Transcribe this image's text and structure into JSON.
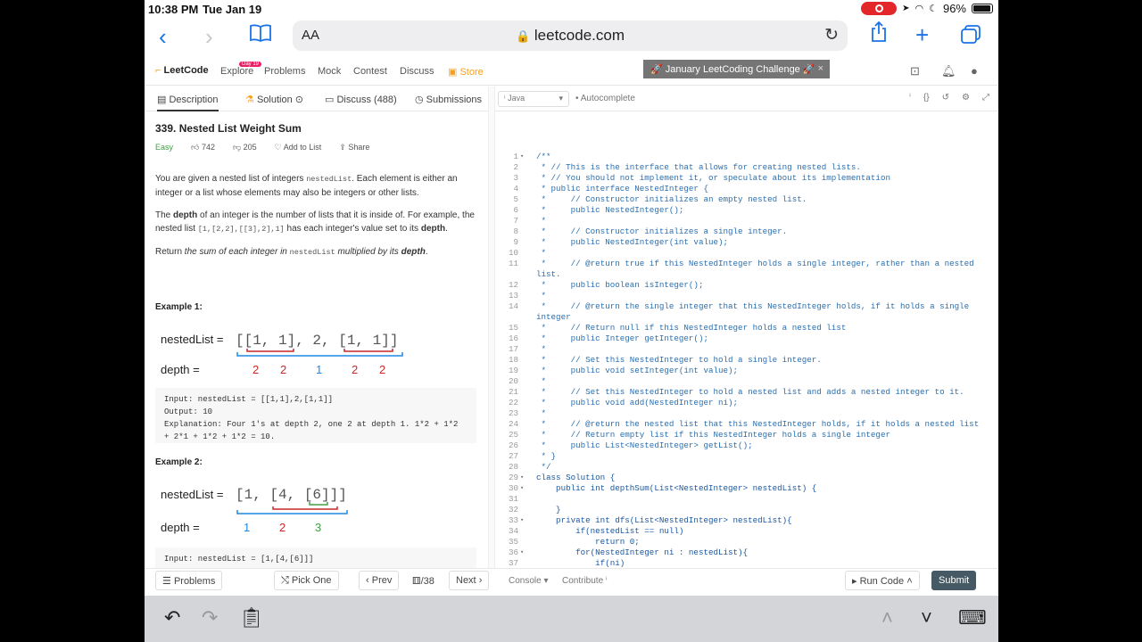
{
  "status": {
    "time": "10:38 PM",
    "date": "Tue Jan 19",
    "battery": "96%"
  },
  "safari": {
    "aa": "AA",
    "url": "leetcode.com"
  },
  "lcnav": {
    "logo_a": "Leet",
    "logo_b": "Code",
    "items": [
      "Explore",
      "Problems",
      "Mock",
      "Contest",
      "Discuss",
      "Store"
    ],
    "badge": "Day 19",
    "banner": "🚀 January LeetCoding Challenge 🚀"
  },
  "tabs": [
    "Description",
    "Solution",
    "Discuss (488)",
    "Submissions"
  ],
  "question": {
    "title": "339. Nested List Weight Sum",
    "difficulty": "Easy",
    "likes": "742",
    "dislikes": "205",
    "add_to_list": "Add to List",
    "share": "Share",
    "p1a": "You are given a nested list of integers ",
    "p1code": "nestedList",
    "p1b": ". Each element is either an integer or a list whose elements may also be integers or other lists.",
    "p2a": "The ",
    "p2bold": "depth",
    "p2b": " of an integer is the number of lists that it is inside of. For example, the nested list ",
    "p2code": "[1,[2,2],[[3],2],1]",
    "p2c": " has each integer's value set to its ",
    "p2bold2": "depth",
    "p2d": ".",
    "p3a": "Return ",
    "p3i": "the sum of each integer in ",
    "p3code": "nestedList",
    "p3i2": " multiplied by its ",
    "p3bold": "depth",
    "p3d": "."
  },
  "examples": {
    "ex1": {
      "head": "Example 1:",
      "label_list": "nestedList =",
      "label_depth": "depth =",
      "list_text": "[[1, 1], 2, [1, 1]]",
      "depths": [
        "2",
        "2",
        "1",
        "2",
        "2"
      ],
      "input": "Input: nestedList = [[1,1],2,[1,1]]",
      "output": "Output: 10",
      "explanation": "Explanation: Four 1's at depth 2, one 2 at depth 1. 1*2 + 1*2 + 2*1 + 1*2 + 1*2 = 10."
    },
    "ex2": {
      "head": "Example 2:",
      "label_list": "nestedList =",
      "label_depth": "depth =",
      "list_text": "[1, [4, [6]]]",
      "depths": [
        "1",
        "2",
        "3"
      ],
      "input": "Input: nestedList = [1,[4,[6]]]"
    }
  },
  "editor": {
    "language": "Java",
    "autocomplete": "Autocomplete",
    "lines": [
      {
        "n": "1",
        "f": "▾",
        "t": "/**",
        "c": "cm"
      },
      {
        "n": "2",
        "f": "",
        "t": " * // This is the interface that allows for creating nested lists.",
        "c": "cm"
      },
      {
        "n": "3",
        "f": "",
        "t": " * // You should not implement it, or speculate about its implementation",
        "c": "cm"
      },
      {
        "n": "4",
        "f": "",
        "t": " * public interface NestedInteger {",
        "c": "cm"
      },
      {
        "n": "5",
        "f": "",
        "t": " *     // Constructor initializes an empty nested list.",
        "c": "cm"
      },
      {
        "n": "6",
        "f": "",
        "t": " *     public NestedInteger();",
        "c": "cm"
      },
      {
        "n": "7",
        "f": "",
        "t": " *",
        "c": "cm"
      },
      {
        "n": "8",
        "f": "",
        "t": " *     // Constructor initializes a single integer.",
        "c": "cm"
      },
      {
        "n": "9",
        "f": "",
        "t": " *     public NestedInteger(int value);",
        "c": "cm"
      },
      {
        "n": "10",
        "f": "",
        "t": " *",
        "c": "cm"
      },
      {
        "n": "11",
        "f": "",
        "t": " *     // @return true if this NestedInteger holds a single integer, rather than a nested",
        "c": "cm"
      },
      {
        "n": "",
        "f": "",
        "t": "list.",
        "c": "cm"
      },
      {
        "n": "12",
        "f": "",
        "t": " *     public boolean isInteger();",
        "c": "cm"
      },
      {
        "n": "13",
        "f": "",
        "t": " *",
        "c": "cm"
      },
      {
        "n": "14",
        "f": "",
        "t": " *     // @return the single integer that this NestedInteger holds, if it holds a single",
        "c": "cm"
      },
      {
        "n": "",
        "f": "",
        "t": "integer",
        "c": "cm"
      },
      {
        "n": "15",
        "f": "",
        "t": " *     // Return null if this NestedInteger holds a nested list",
        "c": "cm"
      },
      {
        "n": "16",
        "f": "",
        "t": " *     public Integer getInteger();",
        "c": "cm"
      },
      {
        "n": "17",
        "f": "",
        "t": " *",
        "c": "cm"
      },
      {
        "n": "18",
        "f": "",
        "t": " *     // Set this NestedInteger to hold a single integer.",
        "c": "cm"
      },
      {
        "n": "19",
        "f": "",
        "t": " *     public void setInteger(int value);",
        "c": "cm"
      },
      {
        "n": "20",
        "f": "",
        "t": " *",
        "c": "cm"
      },
      {
        "n": "21",
        "f": "",
        "t": " *     // Set this NestedInteger to hold a nested list and adds a nested integer to it.",
        "c": "cm"
      },
      {
        "n": "22",
        "f": "",
        "t": " *     public void add(NestedInteger ni);",
        "c": "cm"
      },
      {
        "n": "23",
        "f": "",
        "t": " *",
        "c": "cm"
      },
      {
        "n": "24",
        "f": "",
        "t": " *     // @return the nested list that this NestedInteger holds, if it holds a nested list",
        "c": "cm"
      },
      {
        "n": "25",
        "f": "",
        "t": " *     // Return empty list if this NestedInteger holds a single integer",
        "c": "cm"
      },
      {
        "n": "26",
        "f": "",
        "t": " *     public List<NestedInteger> getList();",
        "c": "cm"
      },
      {
        "n": "27",
        "f": "",
        "t": " * }",
        "c": "cm"
      },
      {
        "n": "28",
        "f": "",
        "t": " */",
        "c": "cm"
      },
      {
        "n": "29",
        "f": "▾",
        "t": "class Solution {",
        "c": "kw"
      },
      {
        "n": "30",
        "f": "▾",
        "t": "    public int depthSum(List<NestedInteger> nestedList) {",
        "c": "kw"
      },
      {
        "n": "31",
        "f": "",
        "t": "",
        "c": "kw"
      },
      {
        "n": "32",
        "f": "",
        "t": "    }",
        "c": "kw"
      },
      {
        "n": "33",
        "f": "▾",
        "t": "    private int dfs(List<NestedInteger> nestedList){",
        "c": "kw"
      },
      {
        "n": "34",
        "f": "",
        "t": "        if(nestedList == null)",
        "c": "kw"
      },
      {
        "n": "35",
        "f": "",
        "t": "            return 0;",
        "c": "kw"
      },
      {
        "n": "36",
        "f": "▾",
        "t": "        for(NestedInteger ni : nestedList){",
        "c": "kw"
      },
      {
        "n": "37",
        "f": "",
        "t": "            if(ni)",
        "c": "kw"
      }
    ]
  },
  "bottom": {
    "problems": "Problems",
    "pick_one": "Pick One",
    "prev": "Prev",
    "counter": "/38",
    "next": "Next",
    "console": "Console",
    "contribute": "Contribute",
    "run_code": "Run Code",
    "submit": "Submit"
  }
}
